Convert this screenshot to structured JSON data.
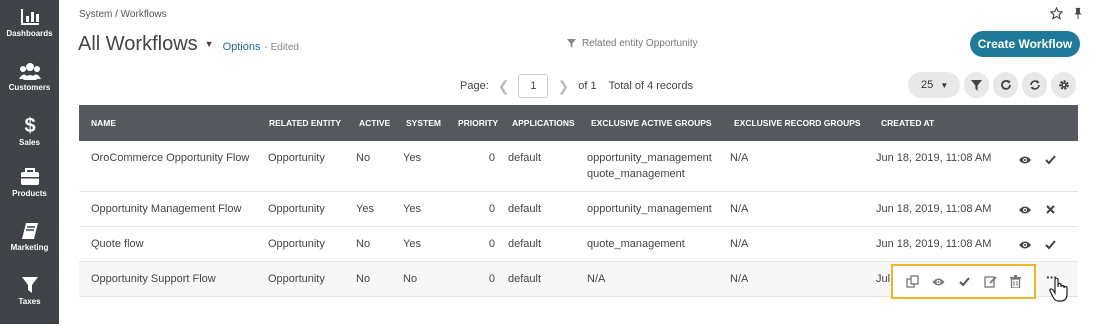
{
  "sidebar": {
    "items": [
      {
        "label": "Dashboards",
        "icon": "bar-chart-icon"
      },
      {
        "label": "Customers",
        "icon": "users-icon"
      },
      {
        "label": "Sales",
        "icon": "dollar-icon"
      },
      {
        "label": "Products",
        "icon": "briefcase-icon"
      },
      {
        "label": "Marketing",
        "icon": "book-icon"
      },
      {
        "label": "Taxes",
        "icon": "filter-icon"
      }
    ]
  },
  "breadcrumb": "System / Workflows",
  "header": {
    "title": "All Workflows",
    "options": "Options",
    "edited": "- Edited",
    "filter_hint": "Related entity Opportunity",
    "create_button": "Create Workflow"
  },
  "pager": {
    "label": "Page:",
    "current": "1",
    "of": "of 1",
    "total": "Total of 4 records",
    "per_page": "25"
  },
  "columns": [
    "NAME",
    "RELATED ENTITY",
    "ACTIVE",
    "SYSTEM",
    "PRIORITY",
    "APPLICATIONS",
    "EXCLUSIVE ACTIVE GROUPS",
    "EXCLUSIVE RECORD GROUPS",
    "CREATED AT"
  ],
  "rows": [
    {
      "name": "OroCommerce Opportunity Flow",
      "entity": "Opportunity",
      "active": "No",
      "system": "Yes",
      "priority": "0",
      "applications": "default",
      "active_groups_1": "opportunity_management",
      "active_groups_2": "quote_management",
      "record_groups": "N/A",
      "created": "Jun 18, 2019, 11:08 AM"
    },
    {
      "name": "Opportunity Management Flow",
      "entity": "Opportunity",
      "active": "Yes",
      "system": "Yes",
      "priority": "0",
      "applications": "default",
      "active_groups_1": "opportunity_management",
      "active_groups_2": "",
      "record_groups": "N/A",
      "created": "Jun 18, 2019, 11:08 AM"
    },
    {
      "name": "Quote flow",
      "entity": "Opportunity",
      "active": "No",
      "system": "Yes",
      "priority": "0",
      "applications": "default",
      "active_groups_1": "quote_management",
      "active_groups_2": "",
      "record_groups": "N/A",
      "created": "Jun 18, 2019, 11:08 AM"
    },
    {
      "name": "Opportunity Support Flow",
      "entity": "Opportunity",
      "active": "No",
      "system": "No",
      "priority": "0",
      "applications": "default",
      "active_groups_1": "N/A",
      "active_groups_2": "",
      "record_groups": "N/A",
      "created": "Jul"
    }
  ],
  "colors": {
    "sidebar": "#3f4246",
    "header": "#55595e",
    "accent": "#1f7a9a",
    "highlight": "#f0b429"
  }
}
